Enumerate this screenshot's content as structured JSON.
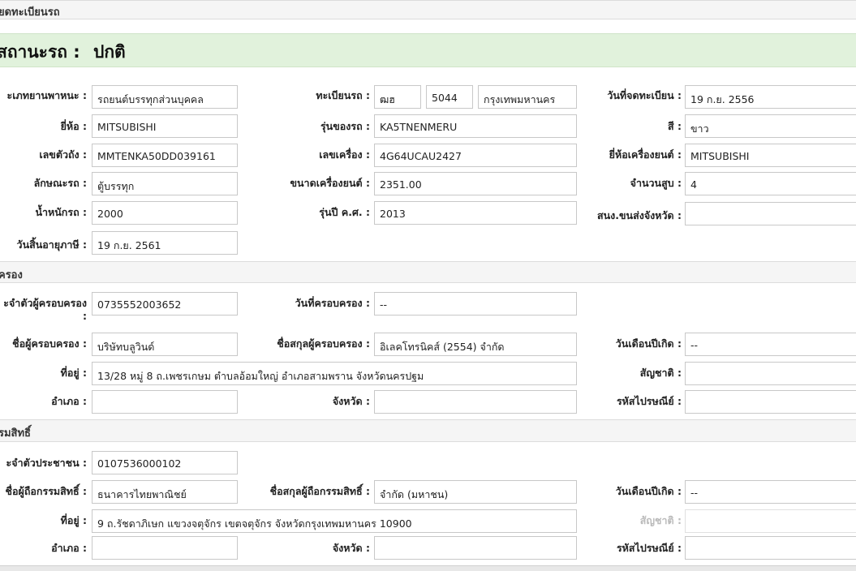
{
  "vehicle_section": {
    "title": "ียดทะเบียนรถ",
    "status_label": "สถานะรถ :",
    "status_value": "ปกติ",
    "vehicle_type_label": "ะเภทยานพาหนะ :",
    "vehicle_type": "รถยนต์บรรทุกส่วนบุคคล",
    "plate_label": "ทะเบียนรถ :",
    "plate_prefix": "ฒฮ",
    "plate_number": "5044",
    "plate_province": "กรุงเทพมหานคร",
    "reg_date_label": "วันที่จดทะเบียน :",
    "reg_date": "19 ก.ย. 2556",
    "brand_label": "ยี่ห้อ :",
    "brand": "MITSUBISHI",
    "model_label": "รุ่นของรถ :",
    "model": "KA5TNENMERU",
    "color_label": "สี :",
    "color": "ขาว",
    "chassis_label": "เลขตัวถัง :",
    "chassis": "MMTENKA50DD039161",
    "engine_label": "เลขเครื่อง :",
    "engine": "4G64UCAU2427",
    "engine_brand_label": "ยี่ห้อเครื่องยนต์ :",
    "engine_brand": "MITSUBISHI",
    "body_label": "ลักษณะรถ :",
    "body": "ตู้บรรทุก",
    "engine_size_label": "ขนาดเครื่องยนต์ :",
    "engine_size": "2351.00",
    "cylinders_label": "จำนวนสูบ :",
    "cylinders": "4",
    "weight_label": "น้ำหนักรถ :",
    "weight": "2000",
    "model_year_label": "รุ่นปี ค.ศ. :",
    "model_year": "2013",
    "transport_office_label": "สนง.ขนส่งจังหวัด :",
    "transport_office": "",
    "tax_expiry_label": "วันสิ้นอายุภาษี :",
    "tax_expiry": "19 ก.ย. 2561"
  },
  "possessor_section": {
    "title": "ครอง",
    "id_label": "ะจำตัวผู้ครอบครอง",
    "id_label_colon": ":",
    "id": "0735552003652",
    "date_label": "วันที่ครอบครอง :",
    "date": "--",
    "name_label": "ชื่อผู้ครอบครอง :",
    "name": "บริษัทบลูวินด์",
    "surname_label": "ชื่อสกุลผู้ครอบครอง :",
    "surname": "อิเลคโทรนิคส์ (2554)  จำกัด",
    "birth_label": "วันเดือนปีเกิด :",
    "birth": "--",
    "address_label": "ที่อยู่ :",
    "address": "13/28    หมู่ 8    ถ.เพชรเกษม ตำบลอ้อมใหญ่ อำเภอสามพราน จังหวัดนครปฐม",
    "nationality_label": "สัญชาติ :",
    "nationality": "",
    "district_label": "อำเภอ :",
    "district": "",
    "province_label": "จังหวัด :",
    "province": "",
    "postcode_label": "รหัสไปรษณีย์ :",
    "postcode": ""
  },
  "owner_section": {
    "title": "รมสิทธิ์",
    "id_label": "ะจำตัวประชาชน :",
    "id": "0107536000102",
    "name_label": "ชื่อผู้ถือกรรมสิทธิ์ :",
    "name": "ธนาคารไทยพาณิชย์",
    "surname_label": "ชื่อสกุลผู้ถือกรรมสิทธิ์ :",
    "surname": "จำกัด (มหาชน)",
    "birth_label": "วันเดือนปีเกิด :",
    "birth": "--",
    "address_label": "ที่อยู่ :",
    "address": "9        ถ.รัชดาภิเษก แขวงจตุจักร เขตจตุจักร จังหวัดกรุงเทพมหานคร 10900",
    "nationality_label": "สัญชาติ :",
    "nationality": "",
    "district_label": "อำเภอ :",
    "district": "",
    "province_label": "จังหวัด :",
    "province": "",
    "postcode_label": "รหัสไปรษณีย์ :",
    "postcode": ""
  },
  "colors": {
    "status_banner_bg": "#e1f2dc",
    "section_header_bg": "#f5f5f5",
    "field_border": "#c8c8c8"
  }
}
